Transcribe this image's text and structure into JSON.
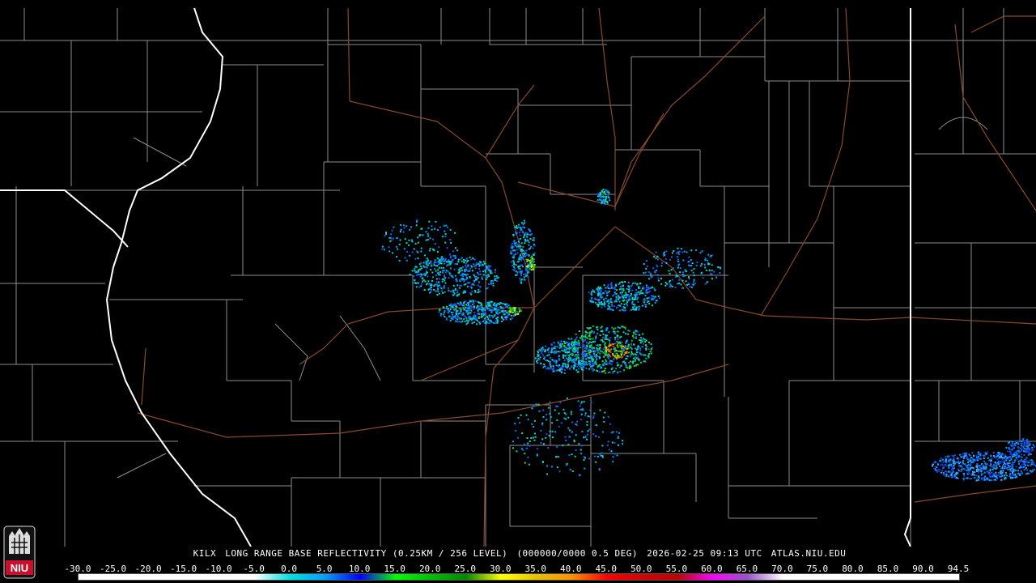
{
  "caption": {
    "station": "KILX",
    "product": "LONG RANGE BASE REFLECTIVITY (0.25KM / 256 LEVEL)",
    "scan": "(000000/0000 0.5 DEG)",
    "datetime": "2026-02-25 09:13 UTC",
    "source": "ATLAS.NIU.EDU"
  },
  "logo": {
    "text": "NIU",
    "color": "#c8102e"
  },
  "colorbar": {
    "labels": [
      "-30.0",
      "-25.0",
      "-20.0",
      "-15.0",
      "-10.0",
      "-5.0",
      "0.0",
      "5.0",
      "10.0",
      "15.0",
      "20.0",
      "25.0",
      "30.0",
      "35.0",
      "40.0",
      "45.0",
      "50.0",
      "55.0",
      "60.0",
      "65.0",
      "70.0",
      "75.0",
      "80.0",
      "85.0",
      "90.0",
      "94.5"
    ],
    "colors": [
      "#ffffff",
      "#ffffff",
      "#ffffff",
      "#ffffff",
      "#ffffff",
      "#ffffff",
      "#00e0e0",
      "#00a0ff",
      "#0000ff",
      "#00ff00",
      "#00c000",
      "#008800",
      "#ffff00",
      "#e7c000",
      "#ff9000",
      "#ff0000",
      "#d60000",
      "#c00000",
      "#ff00ff",
      "#9955c9",
      "#ffffff",
      "#ffffff",
      "#ffffff",
      "#ffffff",
      "#ffffff",
      "#ffffff"
    ]
  },
  "map": {
    "background": "#000000",
    "county_color": "#9a9a9a",
    "road_color": "#8a4a2a",
    "state_color": "#ffffff"
  }
}
